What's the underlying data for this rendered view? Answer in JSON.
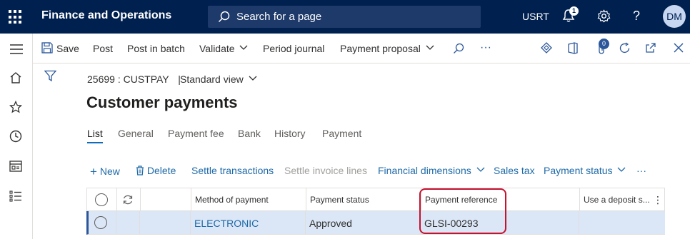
{
  "app": {
    "title": "Finance and Operations",
    "search_placeholder": "Search for a page",
    "company": "USRT",
    "notification_count": "1",
    "user_initials": "DM",
    "help_glyph": "?"
  },
  "actions": {
    "save": "Save",
    "post": "Post",
    "post_in_batch": "Post in batch",
    "validate": "Validate",
    "period_journal": "Period journal",
    "payment_proposal": "Payment proposal",
    "more": "···",
    "attachments_count": "0"
  },
  "record": {
    "id": "25699 : CUSTPAY",
    "separator": "|",
    "view": "Standard view"
  },
  "page_title": "Customer payments",
  "tabs": [
    {
      "label": "List"
    },
    {
      "label": "General"
    },
    {
      "label": "Payment fee"
    },
    {
      "label": "Bank"
    },
    {
      "label": "History"
    },
    {
      "label": "Payment"
    }
  ],
  "grid_toolbar": {
    "new": "New",
    "delete": "Delete",
    "settle_transactions": "Settle transactions",
    "settle_invoice_lines": "Settle invoice lines",
    "financial_dimensions": "Financial dimensions",
    "sales_tax": "Sales tax",
    "payment_status": "Payment status",
    "more": "···"
  },
  "grid": {
    "columns": [
      "Method of payment",
      "Payment status",
      "Payment reference",
      "Use a deposit s..."
    ],
    "rows": [
      {
        "method_of_payment": "ELECTRONIC",
        "payment_status": "Approved",
        "payment_reference": "GLSI-00293",
        "use_deposit": ""
      }
    ]
  },
  "colors": {
    "topbar": "#002050",
    "link": "#1e6aa8",
    "selected_row": "#dbe6f6",
    "highlight": "#c4122f"
  },
  "icons": [
    "waffle-icon",
    "search-icon",
    "bell-icon",
    "gear-icon",
    "help-icon",
    "hamburger-icon",
    "home-icon",
    "star-icon",
    "clock-icon",
    "workspace-icon",
    "list-icon",
    "filter-icon",
    "save-icon",
    "refresh-icon"
  ]
}
